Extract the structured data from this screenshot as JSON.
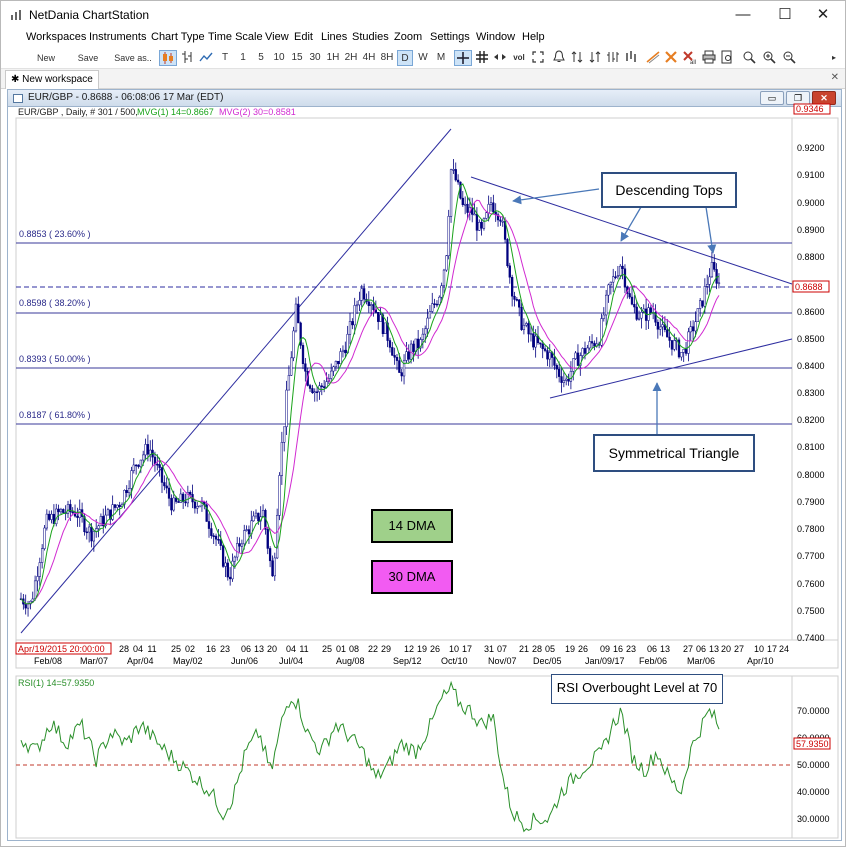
{
  "app": {
    "title": "NetDania ChartStation",
    "window_controls": {
      "minimize": "—",
      "maximize": "☐",
      "close": "✕"
    }
  },
  "menu": [
    "Workspaces",
    "Instruments",
    "Chart Type",
    "Time Scale",
    "View",
    "Edit",
    "Lines",
    "Studies",
    "Zoom",
    "Settings",
    "Window",
    "Help"
  ],
  "toolbar": {
    "new_label": "New",
    "save_label": "Save",
    "save_as_label": "Save as..",
    "timeframes": [
      "T",
      "1",
      "5",
      "10",
      "15",
      "30",
      "1H",
      "2H",
      "4H",
      "8H",
      "D",
      "W",
      "M"
    ],
    "active_timeframe": "D",
    "vol_label": "vol"
  },
  "tabs": [
    {
      "label": "New workspace",
      "marker": "✱"
    }
  ],
  "chart_window": {
    "title": "EUR/GBP - 0.8688 - 06:08:06  17 Mar (EDT)",
    "controls": {
      "minimize": "▭",
      "restore": "❐",
      "close": "✕"
    }
  },
  "main_panel": {
    "legend_symbol": "EUR/GBP , Daily, # 301 / 500,",
    "legend_ma14": "MVG(1) 14=0.8667",
    "legend_ma30": "MVG(2) 30=0.8581",
    "top_price_tag": "0.9346",
    "last_price_tag": "0.8688",
    "cursor_date": "Apr/19/2015 20:00:00",
    "price_ticks": [
      "0.9200",
      "0.9100",
      "0.9000",
      "0.8900",
      "0.8800",
      "0.8700",
      "0.8600",
      "0.8500",
      "0.8400",
      "0.8300",
      "0.8200",
      "0.8100",
      "0.8000",
      "0.7900",
      "0.7800",
      "0.7700",
      "0.7600",
      "0.7500",
      "0.7400"
    ],
    "fib_levels": [
      {
        "label": "0.8853 ( 23.60% )",
        "value": 0.8853
      },
      {
        "label": "0.8598 ( 38.20% )",
        "value": 0.8598
      },
      {
        "label": "0.8393 ( 50.00% )",
        "value": 0.8393
      },
      {
        "label": "0.8187 ( 61.80% )",
        "value": 0.8187
      }
    ],
    "date_ticks_top": [
      "28",
      "04",
      "11",
      "25",
      "02",
      "16",
      "23",
      "06",
      "13",
      "20",
      "04",
      "11",
      "25",
      "01",
      "08",
      "22",
      "29",
      "12",
      "19",
      "26",
      "10",
      "17",
      "31",
      "07",
      "21",
      "28",
      "05",
      "19",
      "26",
      "09",
      "16",
      "23",
      "06",
      "13",
      "27",
      "06",
      "13",
      "20",
      "27",
      "10",
      "17",
      "24"
    ],
    "month_labels": [
      "Feb/08",
      "Mar/07",
      "Apr/04",
      "May/02",
      "Jun/06",
      "Jul/04",
      "Aug/08",
      "Sep/12",
      "Oct/10",
      "Nov/07",
      "Dec/05",
      "Jan/09/17",
      "Feb/06",
      "Mar/06",
      "Apr/10"
    ]
  },
  "annotations": {
    "descending_tops": "Descending Tops",
    "symmetrical_triangle": "Symmetrical Triangle",
    "dma14": "14 DMA",
    "dma30": "30 DMA",
    "rsi_overbought": "RSI Overbought Level at 70"
  },
  "rsi_panel": {
    "legend": "RSI(1) 14=57.9350",
    "last_tag": "57.9350",
    "ticks": [
      "70.0000",
      "60.0000",
      "50.0000",
      "40.0000",
      "30.0000"
    ]
  },
  "colors": {
    "candle": "#00007f",
    "ma14": "#1aa31a",
    "ma30": "#d12ad1",
    "rsi": "#2a8f2a",
    "trend": "#2e2ea0",
    "rsi_midline": "#c0392b",
    "last_price": "#cc0000",
    "dma14_fill": "#9fd08a",
    "dma30_fill": "#f25bf2",
    "callout_border": "#2e4e80"
  }
}
